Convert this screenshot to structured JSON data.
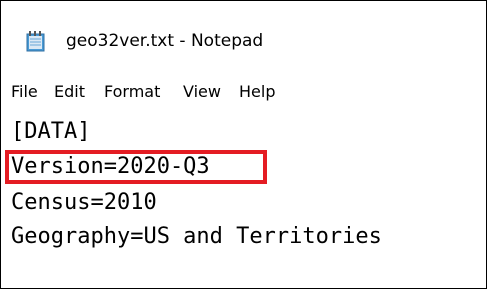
{
  "window": {
    "title": "geo32ver.txt - Notepad",
    "icon": "notepad-icon"
  },
  "menu": {
    "items": [
      "File",
      "Edit",
      "Format",
      "View",
      "Help"
    ]
  },
  "document": {
    "lines": [
      "[DATA]",
      "Version=2020-Q3",
      "Census=2010",
      "Geography=US and Territories"
    ]
  },
  "annotation": {
    "highlight_color": "#e41c23",
    "highlighted_line": "Version=2020-Q3"
  }
}
